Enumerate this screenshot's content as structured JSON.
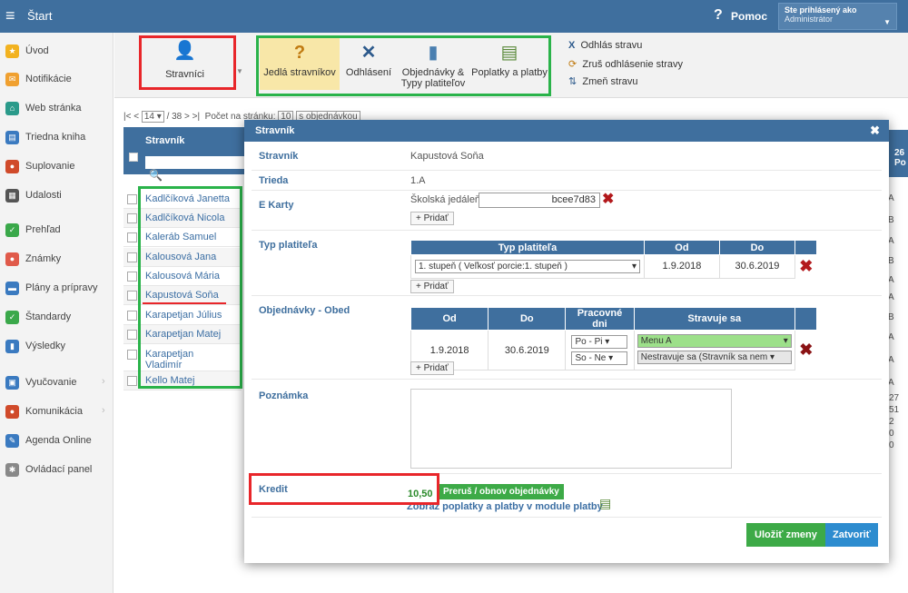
{
  "topbar": {
    "title": "Štart",
    "help_label": "Pomoc",
    "user_label": "Ste prihlásený ako",
    "user_role": "Administrátor"
  },
  "sidebar": {
    "items": [
      {
        "label": "Úvod",
        "icon": "star-icon",
        "color": "#f2b220"
      },
      {
        "label": "Notifikácie",
        "icon": "envelope-icon",
        "color": "#f0a030"
      },
      {
        "label": "Web stránka",
        "icon": "home-icon",
        "color": "#2a9a8a"
      },
      {
        "label": "Triedna kniha",
        "icon": "book-icon",
        "color": "#3a7ac0"
      },
      {
        "label": "Suplovanie",
        "icon": "person-icon",
        "color": "#d04a2a"
      },
      {
        "label": "Udalosti",
        "icon": "calendar-icon",
        "color": "#555555"
      },
      {
        "label": "Prehľad",
        "icon": "check-icon",
        "color": "#3aa84a"
      },
      {
        "label": "Známky",
        "icon": "grade-icon",
        "color": "#e05a4a"
      },
      {
        "label": "Plány a prípravy",
        "icon": "folder-icon",
        "color": "#3a7ac0"
      },
      {
        "label": "Štandardy",
        "icon": "shield-icon",
        "color": "#3aa84a"
      },
      {
        "label": "Výsledky",
        "icon": "bar-chart-icon",
        "color": "#3a7ac0"
      },
      {
        "label": "Vyučovanie",
        "icon": "teach-icon",
        "color": "#3a7ac0"
      },
      {
        "label": "Komunikácia",
        "icon": "chat-icon",
        "color": "#d04a2a"
      },
      {
        "label": "Agenda Online",
        "icon": "pen-icon",
        "color": "#3a7ac0"
      },
      {
        "label": "Ovládací panel",
        "icon": "gear-icon",
        "color": "#888888"
      }
    ]
  },
  "toolbar": {
    "stravnici": "Stravníci",
    "jedla": "Jedlá stravníkov",
    "odhlasenia": "Odhlásení",
    "objednavky_l1": "Objednávky &",
    "objednavky_l2": "Typy platiteľov",
    "poplatky": "Poplatky a platby",
    "quick": [
      "Odhlás stravu",
      "Zruš odhlásenie stravy",
      "Zmeň stravu"
    ]
  },
  "pager": {
    "first": "|< <",
    "page": "14",
    "total": "/ 38",
    "next": "> >|",
    "per_page_label": "Počet na stránku:",
    "per_page": "10",
    "filter": "s objednávkou"
  },
  "grid": {
    "header": "Stravník",
    "rows": [
      "Kadlčíková Janetta",
      "Kadlčíková Nicola",
      "Kaleráb Samuel",
      "Kalousová Jana",
      "Kalousová Mária",
      "Kapustová Soňa",
      "Karapetjan Július",
      "Karapetjan Matej",
      "Karapetjan Vladimír",
      "Kello Matej"
    ],
    "right_head": "26 Po",
    "right_vals": [
      "A",
      "B",
      "A",
      "B",
      "A",
      "A",
      "B",
      "A",
      "A",
      "A"
    ],
    "right_extra": [
      "27",
      "51",
      "2",
      "0",
      "0"
    ]
  },
  "modal": {
    "title": "Stravník",
    "stravnik_label": "Stravník",
    "stravnik_value": "Kapustová Soňa",
    "trieda_label": "Trieda",
    "trieda_value": "1.A",
    "karty_label": "E Karty",
    "karty_name": "Školská jedáleň:",
    "karty_code": "bcee7d83",
    "add_label": "+ Pridať",
    "typ_label": "Typ platiteľa",
    "typ_cols": [
      "Typ platiteľa",
      "Od",
      "Do"
    ],
    "typ_row": {
      "typ": "1. stupeň ( Veľkosť porcie:1. stupeň )",
      "od": "1.9.2018",
      "do": "30.6.2019"
    },
    "obj_label": "Objednávky - Obed",
    "obj_cols": [
      "Od",
      "Do",
      "Pracovné dni",
      "Stravuje sa"
    ],
    "obj_row": {
      "od": "1.9.2018",
      "do": "30.6.2019",
      "dni1": "Po - Pi",
      "dni2": "So - Ne",
      "str1": "Menu A",
      "str2": "Nestravuje sa (Stravník sa nem"
    },
    "poznamka_label": "Poznámka",
    "kredit_label": "Kredit",
    "kredit_value": "10,50",
    "prerus_label": "Preruš / obnov objednávky",
    "zobraz_label": "Zobraz poplatky a platby v module platby",
    "save_label": "Uložiť zmeny",
    "close_label": "Zatvoriť"
  }
}
